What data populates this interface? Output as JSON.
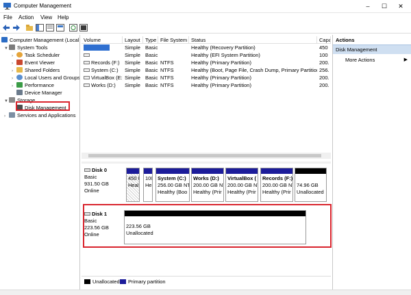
{
  "window": {
    "title": "Computer Management",
    "minimize": "–",
    "maximize": "☐",
    "close": "✕"
  },
  "menu": {
    "file": "File",
    "action": "Action",
    "view": "View",
    "help": "Help"
  },
  "tree": {
    "root": "Computer Management (Local",
    "system_tools": "System Tools",
    "task_scheduler": "Task Scheduler",
    "event_viewer": "Event Viewer",
    "shared_folders": "Shared Folders",
    "local_users": "Local Users and Groups",
    "performance": "Performance",
    "device_manager": "Device Manager",
    "storage": "Storage",
    "disk_management": "Disk Management",
    "services": "Services and Applications"
  },
  "volumes": {
    "headers": [
      "Volume",
      "Layout",
      "Type",
      "File System",
      "Status",
      "Capa"
    ],
    "rows": [
      {
        "volume": "",
        "layout": "Simple",
        "type": "Basic",
        "fs": "",
        "status": "Healthy (Recovery Partition)",
        "cap": "450"
      },
      {
        "volume": "",
        "layout": "Simple",
        "type": "Basic",
        "fs": "",
        "status": "Healthy (EFI System Partition)",
        "cap": "100"
      },
      {
        "volume": "Records (F:)",
        "layout": "Simple",
        "type": "Basic",
        "fs": "NTFS",
        "status": "Healthy (Primary Partition)",
        "cap": "200."
      },
      {
        "volume": "System (C:)",
        "layout": "Simple",
        "type": "Basic",
        "fs": "NTFS",
        "status": "Healthy (Boot, Page File, Crash Dump, Primary Partition)",
        "cap": "256."
      },
      {
        "volume": "VirtualBox (E:)",
        "layout": "Simple",
        "type": "Basic",
        "fs": "NTFS",
        "status": "Healthy (Primary Partition)",
        "cap": "200."
      },
      {
        "volume": "Works (D:)",
        "layout": "Simple",
        "type": "Basic",
        "fs": "NTFS",
        "status": "Healthy (Primary Partition)",
        "cap": "200."
      }
    ]
  },
  "disk0": {
    "name": "Disk 0",
    "kind": "Basic",
    "size": "931.50 GB",
    "state": "Online",
    "parts": [
      {
        "name": "",
        "l1": "450 M",
        "l2": "Heal",
        "color": "#1c1c9a",
        "hatch": true
      },
      {
        "name": "",
        "l1": "100",
        "l2": "He",
        "color": "#1c1c9a",
        "hatch": false
      },
      {
        "name": "System (C:)",
        "l1": "256.00 GB NT",
        "l2": "Healthy (Boo",
        "color": "#1c1c9a",
        "hatch": false
      },
      {
        "name": "Works (D:)",
        "l1": "200.00 GB NT",
        "l2": "Healthy (Prir",
        "color": "#1c1c9a",
        "hatch": false
      },
      {
        "name": "VirtualBox (",
        "l1": "200.00 GB NT",
        "l2": "Healthy (Prir",
        "color": "#1c1c9a",
        "hatch": false
      },
      {
        "name": "Records (F:)",
        "l1": "200.00 GB NT",
        "l2": "Healthy (Prir",
        "color": "#1c1c9a",
        "hatch": false
      },
      {
        "name": "",
        "l1": "74.96 GB",
        "l2": "Unallocated",
        "color": "#000000",
        "hatch": false
      }
    ]
  },
  "disk1": {
    "name": "Disk 1",
    "kind": "Basic",
    "size": "223.56 GB",
    "state": "Online",
    "part": {
      "l1": "223.56 GB",
      "l2": "Unallocated",
      "color": "#000000"
    }
  },
  "legend": {
    "unallocated": "Unallocated",
    "primary": "Primary partition",
    "unalloc_color": "#000000",
    "primary_color": "#1c1c9a"
  },
  "actions": {
    "header": "Actions",
    "section": "Disk Management",
    "more": "More Actions",
    "more_chevron": "▶"
  },
  "colors": {
    "highlight": "#d9232c",
    "selection": "#cfdff1"
  }
}
